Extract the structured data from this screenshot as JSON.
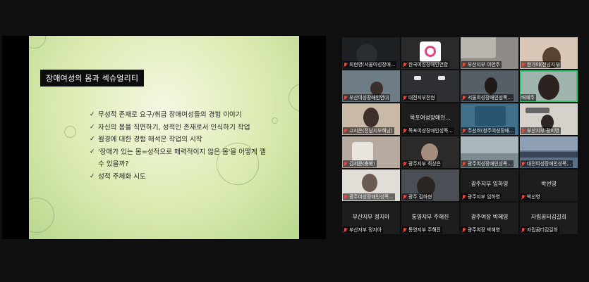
{
  "slide": {
    "title": "장애여성의 몸과 섹슈얼리티",
    "bullets": [
      "무성적 존재로 요구/취급 장애여성들의 경험 이야기",
      "자신의 몸을 직면하기, 성적인 존재로서 인식하기 작업",
      "월경에 대한 경험 해석은 작업의 시작",
      "'장애가 있는 몸=성적으로 매력적이지 않은 몸'을 어떻게 깰 수 있을까?",
      "성적 주체화 시도"
    ]
  },
  "participants": [
    {
      "name": "최현영(서울여성장애...",
      "muted": true,
      "display": ""
    },
    {
      "name": "한국여성장애인연합",
      "muted": true,
      "display": ""
    },
    {
      "name": "부산지부 이연주",
      "muted": true,
      "display": ""
    },
    {
      "name": "한가야(전남지부",
      "muted": true,
      "display": ""
    },
    {
      "name": "부산여성장애인연대",
      "muted": true,
      "display": ""
    },
    {
      "name": "대전지부전현",
      "muted": true,
      "display": ""
    },
    {
      "name": "서울여성장애인성폭...",
      "muted": true,
      "display": ""
    },
    {
      "name": "배혜주",
      "muted": false,
      "display": ""
    },
    {
      "name": "고지은(전남지부해남)",
      "muted": true,
      "display": ""
    },
    {
      "name": "목포여성장애인성폭...",
      "muted": true,
      "display": "목포여성장애인..."
    },
    {
      "name": "주선희(청주여성장애...",
      "muted": true,
      "display": ""
    },
    {
      "name": "부산지부 정미영",
      "muted": true,
      "display": ""
    },
    {
      "name": "김서운(충북)",
      "muted": true,
      "display": ""
    },
    {
      "name": "광주지부 최상은",
      "muted": true,
      "display": ""
    },
    {
      "name": "광주여성장애인성폭...",
      "muted": true,
      "display": ""
    },
    {
      "name": "대전여성장애인성폭...",
      "muted": true,
      "display": ""
    },
    {
      "name": "광주여성장애인성폭...",
      "muted": true,
      "display": ""
    },
    {
      "name": "광주 김하현",
      "muted": true,
      "display": ""
    },
    {
      "name": "광주지부 임하영",
      "muted": true,
      "display": "광주지부 임하영"
    },
    {
      "name": "박선영",
      "muted": true,
      "display": "박선영"
    },
    {
      "name": "부산지부 정지아",
      "muted": true,
      "display": "부산지부 정지아"
    },
    {
      "name": "통영지부 주해진",
      "muted": true,
      "display": "통영지부 주해진"
    },
    {
      "name": "광주여장 박혜영",
      "muted": true,
      "display": "광주여장 박혜영"
    },
    {
      "name": "자립꿈터김길희",
      "muted": true,
      "display": "자립꿈터김길희"
    }
  ],
  "colors": {
    "active_speaker": "#2ecc71",
    "muted_mic": "#e74c3c",
    "background": "#0f0f0f"
  }
}
